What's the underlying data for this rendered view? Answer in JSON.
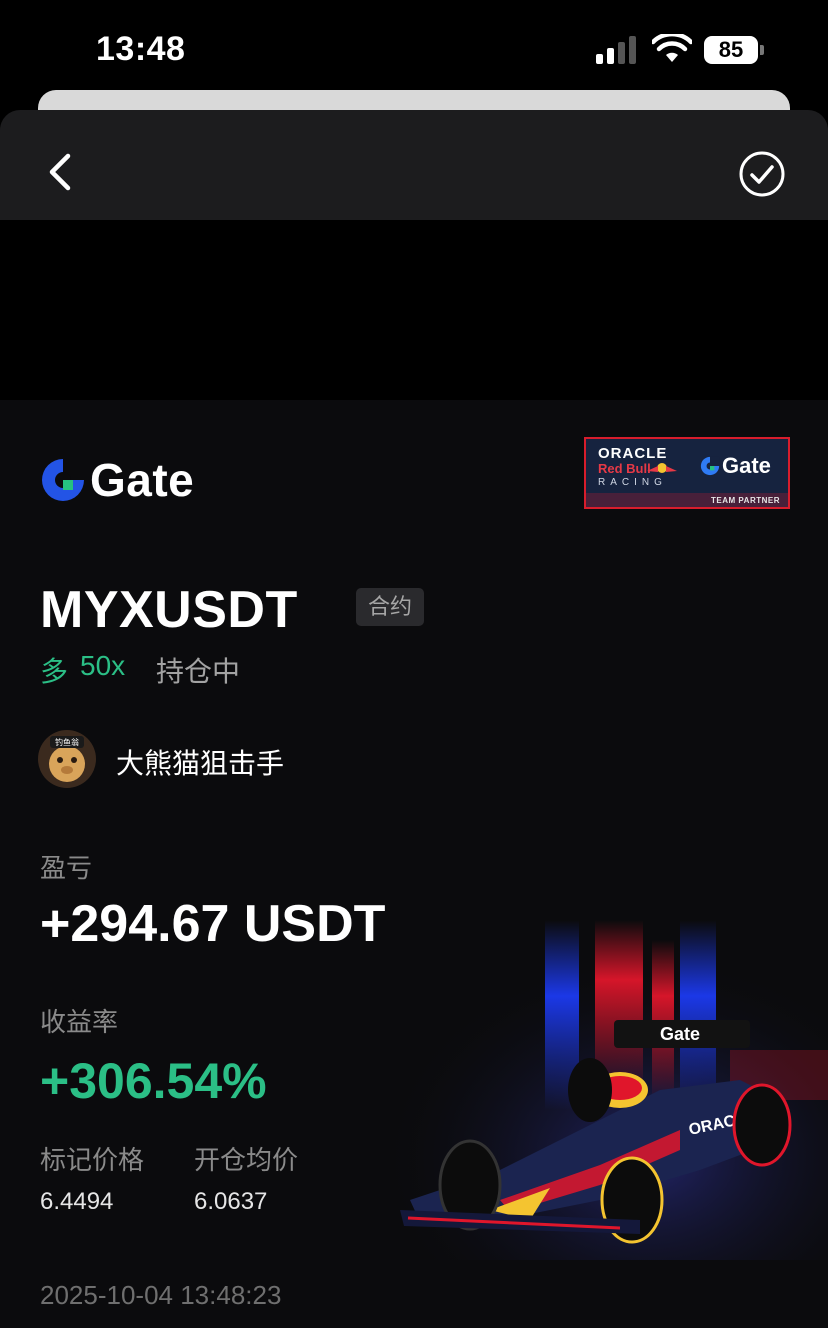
{
  "status_bar": {
    "time": "13:48",
    "battery": "85"
  },
  "card": {
    "brand": "Gate",
    "partner": {
      "line1": "ORACLE",
      "line2": "Red Bull",
      "line3": "RACING",
      "brand": "Gate",
      "caption": "TEAM PARTNER"
    },
    "car_sponsor": "Gate",
    "car_livery": "ORACLE",
    "symbol": "MYXUSDT",
    "contract_tag": "合约",
    "direction": "多",
    "leverage": "50x",
    "position_status": "持仓中",
    "username": "大熊猫狙击手",
    "avatar_badge": "钓鱼翁",
    "pnl_label": "盈亏",
    "pnl_value": "+294.67 USDT",
    "roi_label": "收益率",
    "roi_value": "+306.54%",
    "mark_price_label": "标记价格",
    "mark_price_value": "6.4494",
    "entry_price_label": "开仓均价",
    "entry_price_value": "6.0637",
    "timestamp": "2025-10-04 13:48:23"
  },
  "colors": {
    "accent_green": "#2bbf86",
    "brand_blue": "#2354e6",
    "card_bg": "#0b0b0d",
    "nav_bg": "#1c1c1e"
  },
  "icons": {
    "back": "chevron-left-icon",
    "done": "check-circle-icon",
    "signal": "signal-icon",
    "wifi": "wifi-icon"
  }
}
